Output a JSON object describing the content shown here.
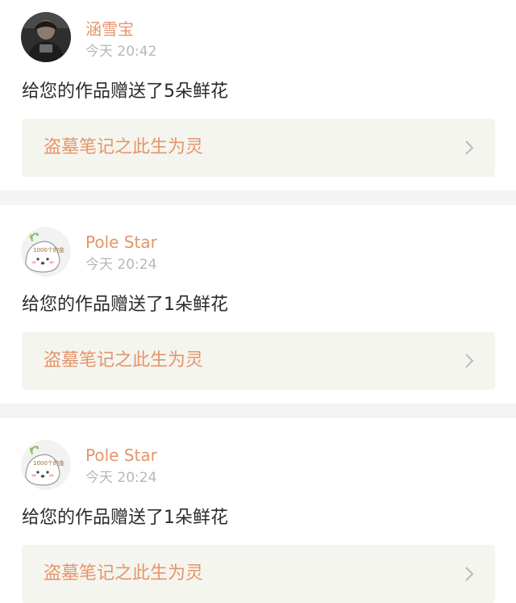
{
  "colors": {
    "accent": "#e4956a",
    "timestamp": "#b7b7b7",
    "message": "#2b2b2b",
    "link_bg": "#f5f5ef",
    "separator": "#f4f4f4"
  },
  "notifications": [
    {
      "username": "涵雪宝",
      "time": "今天 20:42",
      "message": "给您的作品赠送了5朵鲜花",
      "work_title": "盗墓笔记之此生为灵",
      "avatar": "photo-avatar",
      "chevron_icon": "chevron-right-icon"
    },
    {
      "username": "Pole Star",
      "time": "今天 20:24",
      "message": "给您的作品赠送了1朵鲜花",
      "work_title": "盗墓笔记之此生为灵",
      "avatar": "cartoon-avatar",
      "avatar_text": "1000个的金",
      "chevron_icon": "chevron-right-icon"
    },
    {
      "username": "Pole Star",
      "time": "今天 20:24",
      "message": "给您的作品赠送了1朵鲜花",
      "work_title": "盗墓笔记之此生为灵",
      "avatar": "cartoon-avatar",
      "avatar_text": "1000个的金",
      "chevron_icon": "chevron-right-icon"
    }
  ]
}
